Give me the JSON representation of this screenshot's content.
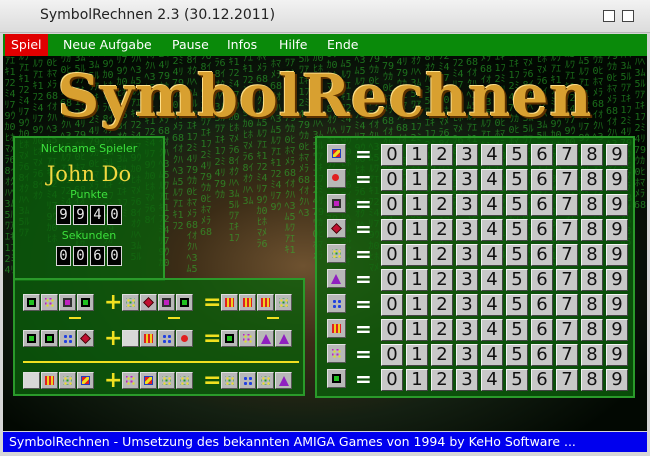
{
  "window": {
    "title": "SymbolRechnen 2.3 (30.12.2011)"
  },
  "menu": {
    "items": [
      "Spiel",
      "Neue Aufgabe",
      "Pause",
      "Infos",
      "Hilfe",
      "Ende"
    ],
    "active": "Spiel",
    "active_color": "#e00000",
    "bar_color": "#0a8a0a"
  },
  "game": {
    "title": "SymbolRechnen"
  },
  "player": {
    "nickname_label": "Nickname Spieler",
    "name": "John Do",
    "points_label": "Punkte",
    "points_digits": [
      "9",
      "9",
      "4",
      "0"
    ],
    "seconds_label": "Sekunden",
    "seconds_digits": [
      "0",
      "0",
      "6",
      "0"
    ]
  },
  "puzzle": {
    "row1": {
      "a": [
        "square",
        "dots2",
        "square-magenta",
        "square"
      ],
      "b": [
        "dots4",
        "diamond-red",
        "square-magenta",
        "square"
      ],
      "c": [
        "bars",
        "bars",
        "bars",
        "dots4"
      ]
    },
    "row2": {
      "a": [
        "square",
        "square",
        "dots-blue",
        "diamond-red"
      ],
      "b": [
        "blank",
        "bars",
        "dots-blue",
        "circle-red"
      ],
      "c": [
        "square",
        "dots2",
        "triangle",
        "triangle"
      ]
    },
    "row3": {
      "a": [
        "blank",
        "bars",
        "dots4",
        "hourglass"
      ],
      "b": [
        "dots2",
        "hourglass",
        "dots4",
        "dots4"
      ],
      "c": [
        "dots4",
        "dots-blue",
        "dots4",
        "triangle"
      ]
    }
  },
  "solution": {
    "symbols": [
      "hourglass",
      "circle-red",
      "square-magenta",
      "diamond-red",
      "dots4",
      "triangle",
      "dots-blue",
      "bars",
      "dots2",
      "square"
    ],
    "equals": "=",
    "numbers": [
      "0",
      "1",
      "2",
      "3",
      "4",
      "5",
      "6",
      "7",
      "8",
      "9"
    ]
  },
  "status": {
    "text": "SymbolRechnen - Umsetzung des bekannten AMIGA Games von 1994 by KeHo Software ...",
    "color": "#0000ee"
  }
}
